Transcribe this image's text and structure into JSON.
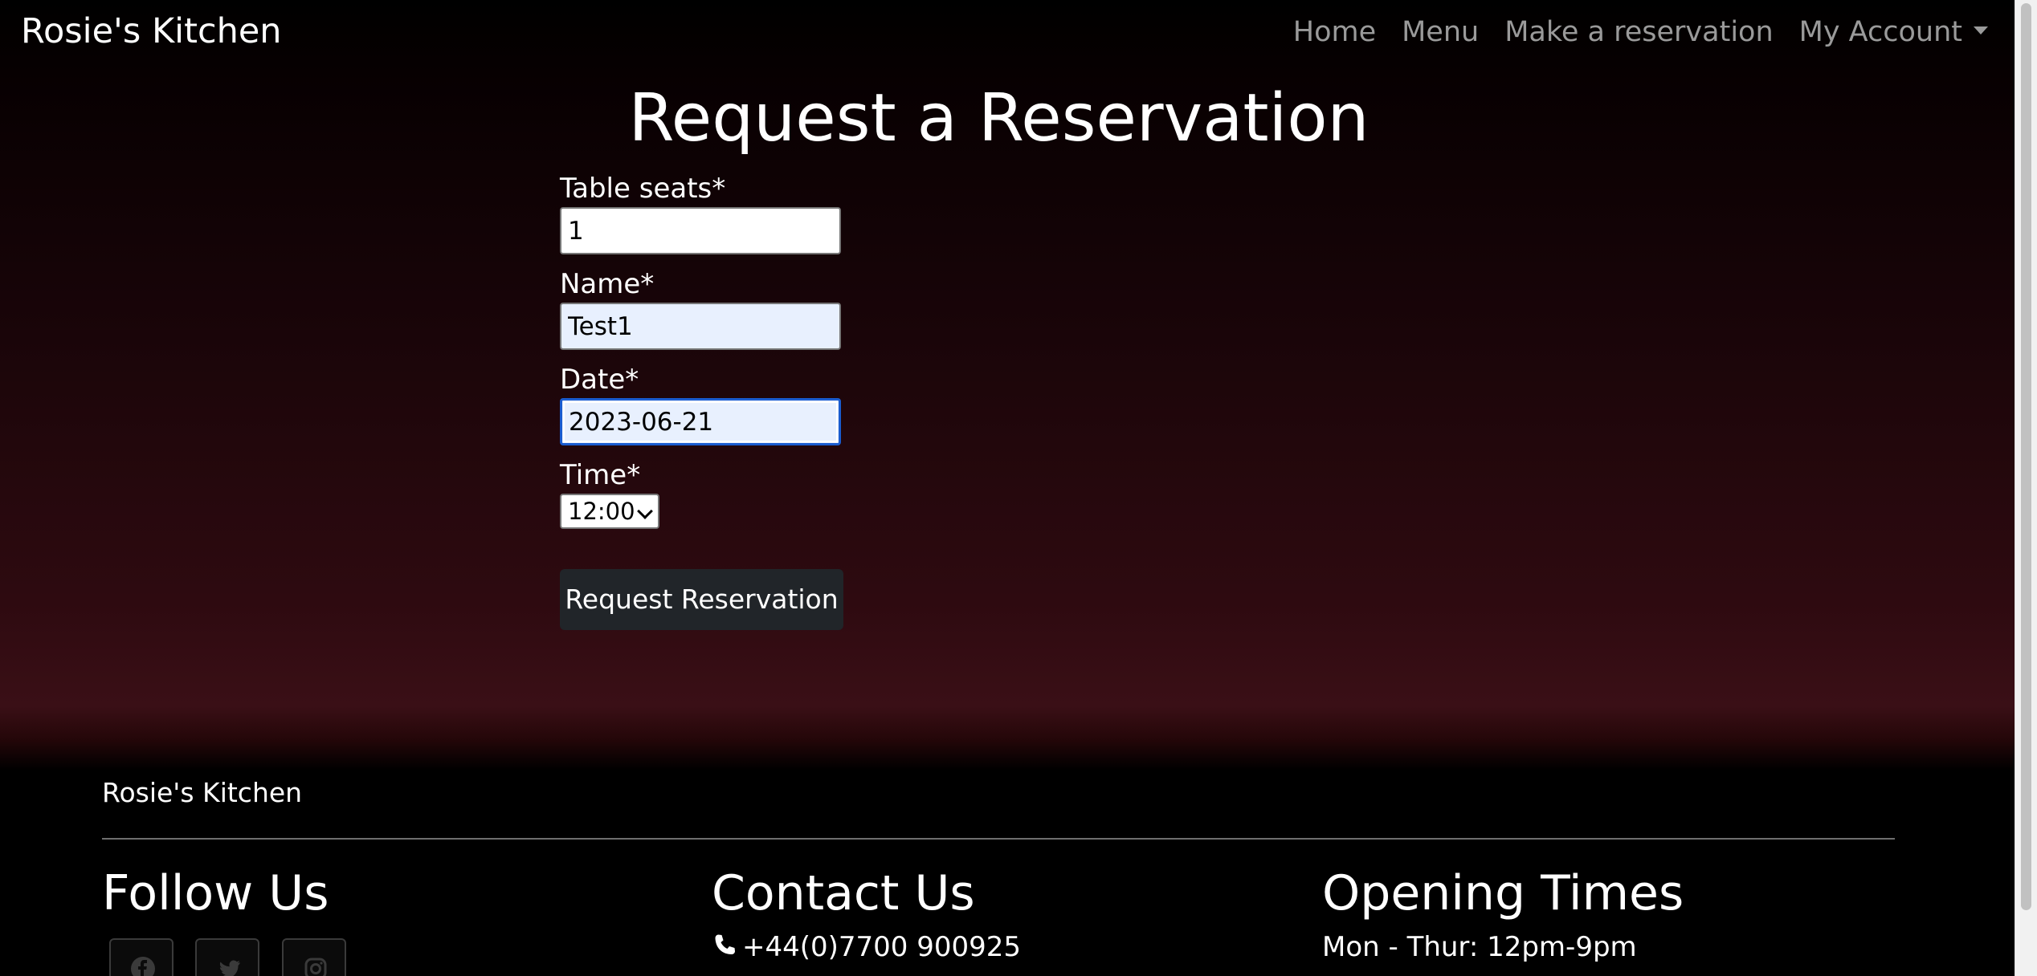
{
  "navbar": {
    "brand": "Rosie's Kitchen",
    "items": [
      {
        "label": "Home"
      },
      {
        "label": "Menu"
      },
      {
        "label": "Make a reservation"
      },
      {
        "label": "My Account"
      }
    ]
  },
  "main": {
    "title": "Request a Reservation",
    "form": {
      "table_seats": {
        "label": "Table seats*",
        "value": "1"
      },
      "name": {
        "label": "Name*",
        "value": "Test1"
      },
      "date": {
        "label": "Date*",
        "value": "2023-06-21"
      },
      "time": {
        "label": "Time*",
        "value": "12:00"
      },
      "submit_label": "Request Reservation"
    }
  },
  "footer": {
    "brand": "Rosie's Kitchen",
    "follow": {
      "heading": "Follow Us",
      "icons": [
        "facebook-icon",
        "twitter-icon",
        "instagram-icon"
      ]
    },
    "contact": {
      "heading": "Contact Us",
      "phone": "+44(0)7700 900925"
    },
    "hours": {
      "heading": "Opening Times",
      "line1": "Mon - Thur: 12pm-9pm"
    }
  }
}
